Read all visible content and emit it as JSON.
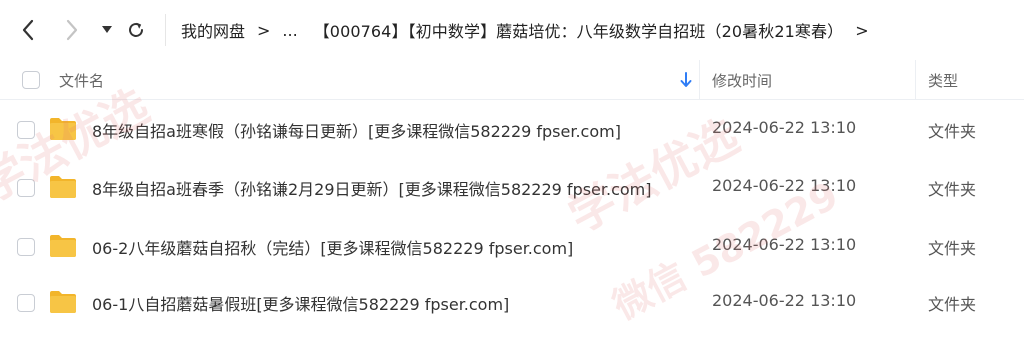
{
  "toolbar": {
    "back_icon": "chevron-left-icon",
    "forward_icon": "chevron-right-icon",
    "dropdown_icon": "caret-down-icon",
    "refresh_icon": "refresh-icon"
  },
  "breadcrumb": {
    "root": "我的网盘",
    "separator": ">",
    "ellipsis": "...",
    "current": "【000764】【初中数学】蘑菇培优：八年级数学自招班（20暑秋21寒春）",
    "trailing_separator": ">"
  },
  "header": {
    "name": "文件名",
    "modified": "修改时间",
    "type": "类型",
    "sort_icon": "arrow-down-icon",
    "sort_color": "#2f7df6"
  },
  "files": [
    {
      "name": "8年级自招a班寒假（孙铭谦每日更新）[更多课程微信582229 fpser.com]",
      "modified": "2024-06-22 13:10",
      "type": "文件夹"
    },
    {
      "name": "8年级自招a班春季（孙铭谦2月29日更新）[更多课程微信582229 fpser.com]",
      "modified": "2024-06-22 13:10",
      "type": "文件夹"
    },
    {
      "name": "06-2八年级蘑菇自招秋（完结）[更多课程微信582229 fpser.com]",
      "modified": "2024-06-22 13:10",
      "type": "文件夹"
    },
    {
      "name": "06-1八自招蘑菇暑假班[更多课程微信582229 fpser.com]",
      "modified": "2024-06-22 13:10",
      "type": "文件夹"
    }
  ],
  "folder_color": "#f7c545",
  "watermark": {
    "line1": "学法优选",
    "line2": "微信 582229"
  }
}
